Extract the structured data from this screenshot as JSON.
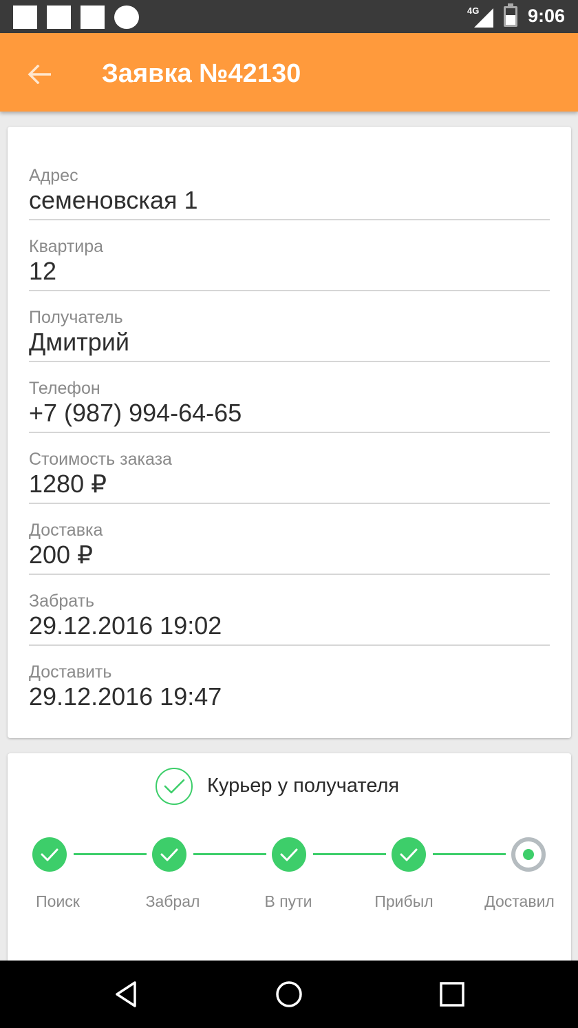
{
  "status_bar": {
    "network": "4G",
    "time": "9:06"
  },
  "app_bar": {
    "title": "Заявка №42130",
    "back_icon": "arrow-back-icon"
  },
  "order": {
    "fields": [
      {
        "label": "Адрес",
        "value": "семеновская 1"
      },
      {
        "label": "Квартира",
        "value": "12"
      },
      {
        "label": "Получатель",
        "value": "Дмитрий"
      },
      {
        "label": "Телефон",
        "value": "+7 (987) 994-64-65"
      },
      {
        "label": "Стоимость заказа",
        "value": "1280 ₽"
      },
      {
        "label": "Доставка",
        "value": "200 ₽"
      },
      {
        "label": "Забрать",
        "value": "29.12.2016 19:02"
      },
      {
        "label": "Доставить",
        "value": "29.12.2016 19:47"
      }
    ]
  },
  "tracking": {
    "status_text": "Курьер у получателя",
    "steps": [
      {
        "label": "Поиск",
        "state": "done"
      },
      {
        "label": "Забрал",
        "state": "done"
      },
      {
        "label": "В пути",
        "state": "done"
      },
      {
        "label": "Прибыл",
        "state": "done"
      },
      {
        "label": "Доставил",
        "state": "current"
      }
    ]
  },
  "colors": {
    "accent": "#ff9a3c",
    "success": "#3dce6a",
    "pending": "#b5bcc0"
  }
}
